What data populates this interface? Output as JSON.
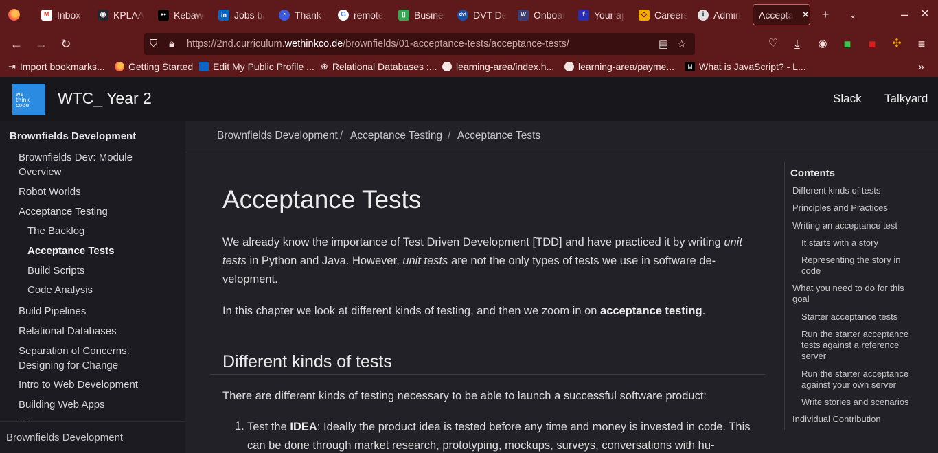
{
  "browser": {
    "tabs": [
      {
        "title": "Inbox -",
        "fav_color": "#ea4335",
        "fav_glyph": "M"
      },
      {
        "title": "KPLAAK",
        "fav_color": "#24292e",
        "fav_glyph": "◉"
      },
      {
        "title": "Kebawe",
        "fav_color": "#000000",
        "fav_glyph": "●●"
      },
      {
        "title": "Jobs ba",
        "fav_color": "#0a66c2",
        "fav_glyph": "in"
      },
      {
        "title": "Thank y",
        "fav_color": "#3b5bdb",
        "fav_glyph": "◔"
      },
      {
        "title": "remote",
        "fav_color": "#ffffff",
        "fav_glyph": "G"
      },
      {
        "title": "Busines",
        "fav_color": "#34a853",
        "fav_glyph": "▯"
      },
      {
        "title": "DVT Dev",
        "fav_color": "#1d4fa5",
        "fav_glyph": "dvt"
      },
      {
        "title": "Onboar",
        "fav_color": "#3f3f72",
        "fav_glyph": "W"
      },
      {
        "title": "Your ap",
        "fav_color": "#2b2bb5",
        "fav_glyph": "f"
      },
      {
        "title": "Careers",
        "fav_color": "#f2a900",
        "fav_glyph": "◇"
      },
      {
        "title": "Admin",
        "fav_color": "#e0e0e0",
        "fav_glyph": "i"
      },
      {
        "title": "Acceptan",
        "fav_color": "",
        "fav_glyph": ""
      }
    ],
    "url_prefix": "https://2nd.curriculum.",
    "url_domain": "wethinkco.de",
    "url_path": "/brownfields/01-acceptance-tests/acceptance-tests/",
    "bookmarks": [
      {
        "label": "Import bookmarks...",
        "color": "#f5e6e6"
      },
      {
        "label": "Getting Started",
        "color": "#ff7139"
      },
      {
        "label": "Edit My Public Profile ...",
        "color": "#0a66c2"
      },
      {
        "label": "Relational Databases :...",
        "color": "#cccccc"
      },
      {
        "label": "learning-area/index.h...",
        "color": "#f5e6e6"
      },
      {
        "label": "learning-area/payme...",
        "color": "#f5e6e6"
      },
      {
        "label": "What is JavaScript? - L...",
        "color": "#000000"
      }
    ]
  },
  "site": {
    "logo_lines": [
      "we",
      "think",
      "code_"
    ],
    "title": "WTC_ Year 2",
    "links": [
      "Slack",
      "Talkyard"
    ]
  },
  "sidebar": {
    "heading": "Brownfields Development",
    "items": [
      {
        "label": "Brownfields Dev: Module Overview"
      },
      {
        "label": "Robot Worlds"
      },
      {
        "label": "Acceptance Testing"
      },
      {
        "label": "The Backlog"
      },
      {
        "label": "Acceptance Tests"
      },
      {
        "label": "Build Scripts"
      },
      {
        "label": "Code Analysis"
      },
      {
        "label": "Build Pipelines"
      },
      {
        "label": "Relational Databases"
      },
      {
        "label": "Separation of Concerns: Designing for Change"
      },
      {
        "label": "Intro to Web Development"
      },
      {
        "label": "Building Web Apps"
      },
      {
        "label": "W..."
      }
    ],
    "footer": "Brownfields Development"
  },
  "breadcrumb": [
    "Brownfields Development",
    "Acceptance Testing",
    "Acceptance Tests"
  ],
  "article": {
    "title": "Acceptance Tests",
    "p1_a": "We already know the importance of Test Driven Development [TDD] and have practiced it by writing ",
    "p1_em1": "unit tests",
    "p1_b": " in Python and Java. However, ",
    "p1_em2": "unit tests",
    "p1_c": " are not the only types of tests we use in software de-velopment.",
    "p2_a": "In this chapter we look at different kinds of testing, and then we zoom in on ",
    "p2_strong": "acceptance testing",
    "p2_b": ".",
    "h2": "Different kinds of tests",
    "p3": "There are different kinds of testing necessary to be able to launch a successful software product:",
    "li1_num": "1.",
    "li1_a": "Test the ",
    "li1_strong": "IDEA",
    "li1_b": ": Ideally the product idea is tested before any time and money is invested in code. This can be done through market research, prototyping, mockups, surveys, conversations with hu-"
  },
  "toc": {
    "heading": "Contents",
    "items": [
      {
        "label": "Different kinds of tests"
      },
      {
        "label": "Principles and Practices"
      },
      {
        "label": "Writing an acceptance test"
      },
      {
        "label": "It starts with a story"
      },
      {
        "label": "Representing the story in code"
      },
      {
        "label": "What you need to do for this goal"
      },
      {
        "label": "Starter acceptance tests"
      },
      {
        "label": "Run the starter acceptance tests against a reference server"
      },
      {
        "label": "Run the starter acceptance against your own server"
      },
      {
        "label": "Write stories and scenarios"
      },
      {
        "label": "Individual Contribution"
      }
    ]
  }
}
